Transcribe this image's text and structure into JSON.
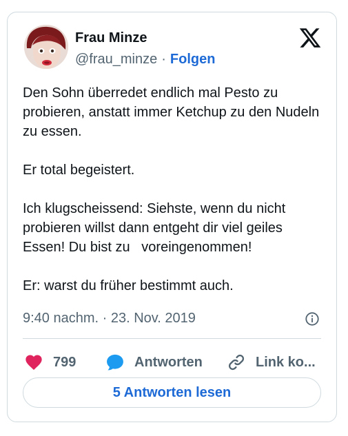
{
  "author": {
    "display_name": "Frau Minze",
    "handle": "@frau_minze",
    "separator": "·",
    "follow_label": "Folgen"
  },
  "tweet": {
    "paragraphs": [
      "Den Sohn überredet endlich mal Pesto zu probieren, anstatt immer Ketchup zu den Nudeln zu essen.",
      "Er total begeistert.",
      "Ich klugscheissend: Siehste, wenn du nicht probieren willst dann entgeht dir viel geiles Essen! Du bist zu   voreingenommen!",
      "Er: warst du früher bestimmt auch."
    ],
    "timestamp": "9:40 nachm. · 23. Nov. 2019"
  },
  "actions": {
    "like_count": "799",
    "reply_label": "Antworten",
    "link_label": "Link ko..."
  },
  "read_replies_label": "5 Antworten lesen",
  "icons": {
    "logo": "x-logo-icon",
    "info": "info-icon",
    "like": "heart-icon",
    "reply": "speech-bubble-icon",
    "link": "link-icon"
  },
  "colors": {
    "accent_blue": "#1d6ad6",
    "heart": "#e0245e",
    "reply_bubble": "#1d9bf0",
    "secondary_text": "#536471",
    "border": "#cfd9de"
  }
}
